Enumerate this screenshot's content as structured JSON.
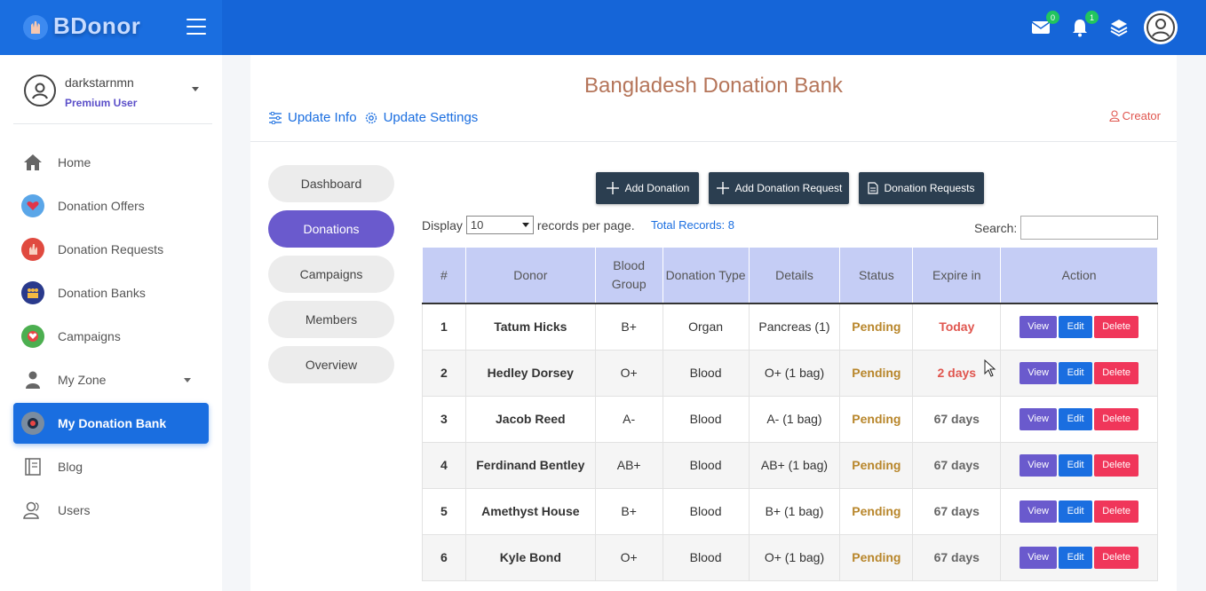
{
  "brand": {
    "name": "BDonor"
  },
  "topbar": {
    "mail_count": "0",
    "notif_count": "1"
  },
  "user": {
    "name": "darkstarnmn",
    "role": "Premium User"
  },
  "nav": [
    {
      "label": "Home",
      "icon": "home-icon"
    },
    {
      "label": "Donation Offers",
      "icon": "heart-hand-icon"
    },
    {
      "label": "Donation Requests",
      "icon": "hand-icon"
    },
    {
      "label": "Donation Banks",
      "icon": "people-icon"
    },
    {
      "label": "Campaigns",
      "icon": "campaign-icon"
    },
    {
      "label": "My Zone",
      "icon": "person-icon"
    },
    {
      "label": "My Donation Bank",
      "icon": "bank-icon"
    },
    {
      "label": "Blog",
      "icon": "book-icon"
    },
    {
      "label": "Users",
      "icon": "users-icon"
    }
  ],
  "page": {
    "title": "Bangladesh Donation Bank",
    "update_info": "Update Info",
    "update_settings": "Update Settings",
    "creator": "Creator"
  },
  "tabs": [
    "Dashboard",
    "Donations",
    "Campaigns",
    "Members",
    "Overview"
  ],
  "actions": {
    "add_donation": "Add Donation",
    "add_request": "Add Donation Request",
    "requests": "Donation Requests"
  },
  "table_controls": {
    "display": "Display",
    "per_page_value": "10",
    "per_page_suffix": "records per page.",
    "total": "Total Records: 8",
    "search_label": "Search:"
  },
  "table": {
    "headers": [
      "#",
      "Donor",
      "Blood Group",
      "Donation Type",
      "Details",
      "Status",
      "Expire in",
      "Action"
    ],
    "rows": [
      {
        "num": "1",
        "donor": "Tatum Hicks",
        "group": "B+",
        "type": "Organ",
        "details": "Pancreas (1)",
        "status": "Pending",
        "expire": "Today"
      },
      {
        "num": "2",
        "donor": "Hedley Dorsey",
        "group": "O+",
        "type": "Blood",
        "details": "O+ (1 bag)",
        "status": "Pending",
        "expire": "2 days"
      },
      {
        "num": "3",
        "donor": "Jacob Reed",
        "group": "A-",
        "type": "Blood",
        "details": "A- (1 bag)",
        "status": "Pending",
        "expire": "67 days"
      },
      {
        "num": "4",
        "donor": "Ferdinand Bentley",
        "group": "AB+",
        "type": "Blood",
        "details": "AB+ (1 bag)",
        "status": "Pending",
        "expire": "67 days"
      },
      {
        "num": "5",
        "donor": "Amethyst House",
        "group": "B+",
        "type": "Blood",
        "details": "B+ (1 bag)",
        "status": "Pending",
        "expire": "67 days"
      },
      {
        "num": "6",
        "donor": "Kyle Bond",
        "group": "O+",
        "type": "Blood",
        "details": "O+ (1 bag)",
        "status": "Pending",
        "expire": "67 days"
      }
    ],
    "btn_view": "View",
    "btn_edit": "Edit",
    "btn_delete": "Delete"
  },
  "colors": {
    "primary": "#1a6ee0",
    "purple": "#6a5acd",
    "danger": "#f0365a",
    "pending": "#b8862b",
    "urgent": "#e0564f"
  }
}
